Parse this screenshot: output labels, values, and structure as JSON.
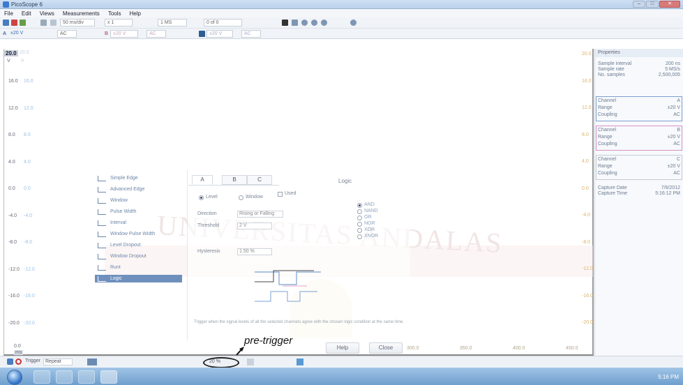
{
  "window": {
    "title": "PicoScope 6"
  },
  "menu": [
    "File",
    "Edit",
    "Views",
    "Measurements",
    "Tools",
    "Help"
  ],
  "toolbar1": {
    "timebase": "50 ms/div",
    "zoom": "x 1",
    "samples": "1 MS",
    "capture": "0 of 0"
  },
  "toolbar2": {
    "channel_a_label": "A",
    "channel_a_range": "±20 V",
    "channel_a_coupling": "AC",
    "channel_b_label": "B",
    "channel_b_range": "±20 V",
    "channel_b_coupling": "AC",
    "channel_c_range": "±20 V",
    "channel_c_coupling": "AC"
  },
  "axis": {
    "top_left": "20.0",
    "unit": "V",
    "y_ticks": [
      "16.0",
      "12.0",
      "8.0",
      "4.0",
      "0.0",
      "-4.0",
      "-8.0",
      "-12.0",
      "-16.0",
      "-20.0"
    ],
    "y_ticks_b": [
      "16.0",
      "12.0",
      "8.0",
      "4.0",
      "0.0",
      "-4.0",
      "-8.0",
      "-12.0",
      "-16.0",
      "-20.0"
    ],
    "y_ticks_right": [
      "20.0",
      "16.0",
      "12.0",
      "8.0",
      "4.0",
      "0.0",
      "-4.0",
      "-8.0",
      "-12.0",
      "-16.0",
      "-20.0"
    ],
    "x_start": "0.0",
    "x_unit": "ms",
    "x_ticks": [
      "300.0",
      "350.0",
      "400.0",
      "450.0"
    ]
  },
  "trigger_list": [
    {
      "label": "Simple Edge",
      "icon": "edge-icon"
    },
    {
      "label": "Advanced Edge",
      "icon": "edge-icon"
    },
    {
      "label": "Window",
      "icon": "window-icon"
    },
    {
      "label": "Pulse Width",
      "icon": "pulse-icon"
    },
    {
      "label": "Interval",
      "icon": "interval-icon"
    },
    {
      "label": "Window Pulse Width",
      "icon": "pulse-icon"
    },
    {
      "label": "Level Dropout",
      "icon": "dropout-icon"
    },
    {
      "label": "Window Dropout",
      "icon": "dropout-icon"
    },
    {
      "label": "Runt",
      "icon": "runt-icon"
    },
    {
      "label": "Logic",
      "icon": "logic-icon"
    }
  ],
  "logic_panel": {
    "tabs": [
      "A",
      "B",
      "C"
    ],
    "level_label": "Level",
    "window_label": "Window",
    "used_label": "Used",
    "logic_title": "Logic",
    "direction_label": "Direction",
    "direction_value": "Rising or Falling",
    "threshold_label": "Threshold",
    "threshold_value": "2 V",
    "hysteresis_label": "Hysteresis",
    "hysteresis_value": "1.50 %",
    "logic_options": [
      "AND",
      "NAND",
      "OR",
      "NOR",
      "XOR",
      "XNOR"
    ],
    "description": "Trigger when the signal levels of all the selected channels agree with the chosen logic condition at the same time.",
    "help_button": "Help",
    "close_button": "Close"
  },
  "watermark": "UNIVERSITAS ANDALAS",
  "annotation": {
    "pre_trigger": "pre-trigger"
  },
  "properties": {
    "title": "Properties",
    "rows": [
      {
        "k": "Sample interval",
        "v": "200 ns"
      },
      {
        "k": "Sample rate",
        "v": "5 MS/s"
      },
      {
        "k": "No. samples",
        "v": "2,500,005"
      }
    ],
    "channels": [
      {
        "channel": "A",
        "range": "±20 V",
        "coupling": "AC"
      },
      {
        "channel": "B",
        "range": "±20 V",
        "coupling": "AC"
      },
      {
        "channel": "C",
        "range": "±20 V",
        "coupling": "AC"
      }
    ],
    "channel_label": "Channel",
    "range_label": "Range",
    "coupling_label": "Coupling",
    "capture_date_label": "Capture Date",
    "capture_date": "7/6/2012",
    "capture_time_label": "Capture Time",
    "capture_time": "5:16:12 PM"
  },
  "statusbar": {
    "trigger_label": "Trigger",
    "trigger_mode": "Repeat",
    "pretrigger_value": "20 %"
  },
  "taskbar": {
    "time": "5:16 PM"
  }
}
